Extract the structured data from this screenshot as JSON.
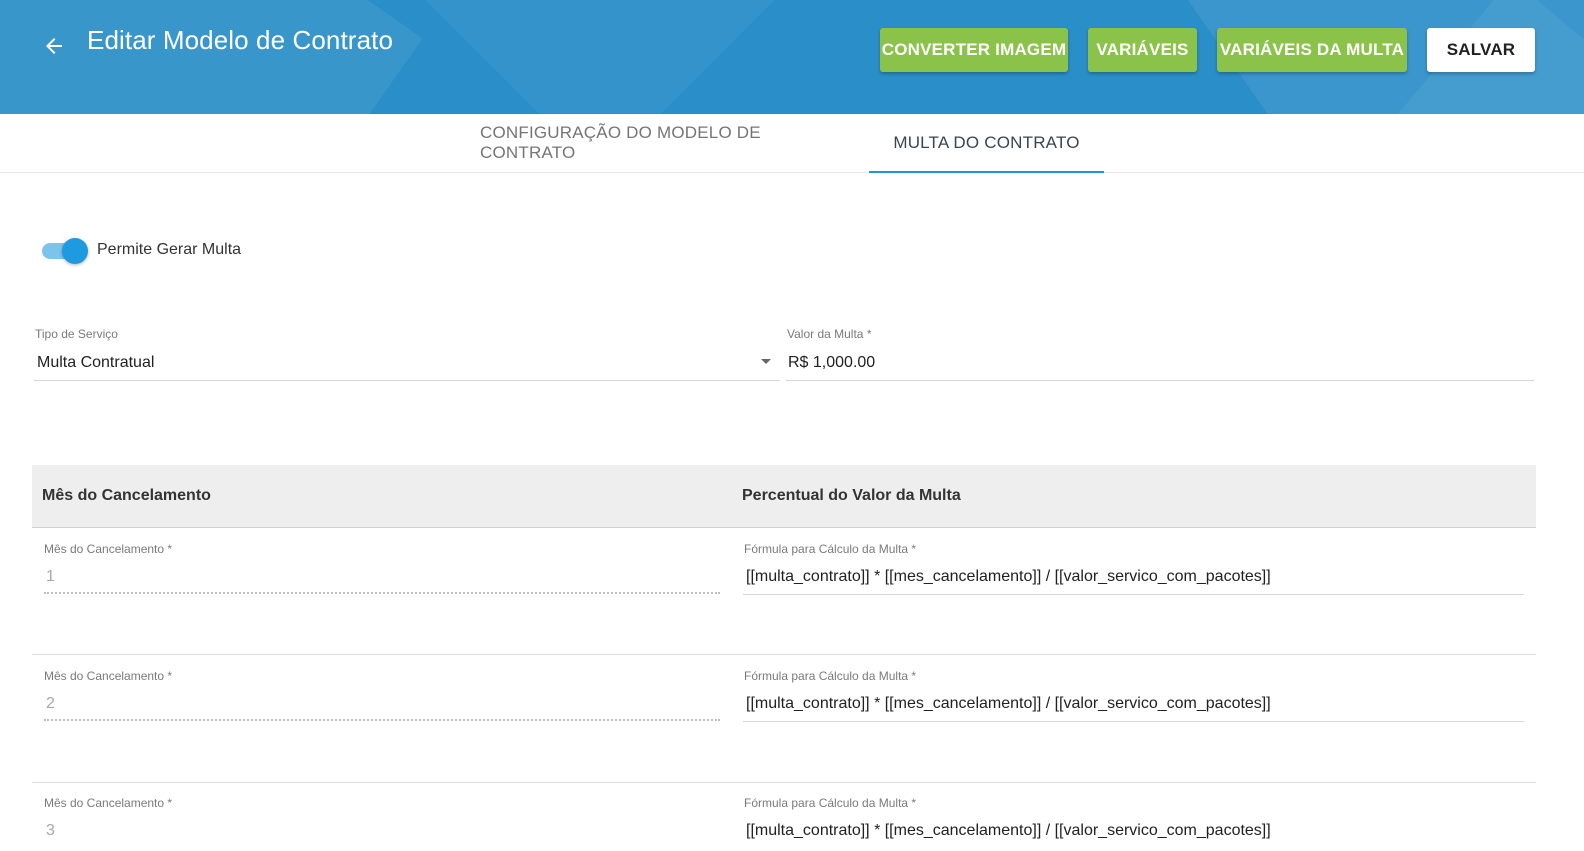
{
  "header": {
    "title": "Editar Modelo de Contrato",
    "buttons": {
      "converter": "CONVERTER IMAGEM",
      "variaveis": "VARIÁVEIS",
      "variaveis_multa": "VARIÁVEIS DA MULTA",
      "salvar": "SALVAR"
    },
    "colors": {
      "bar": "#2a8ec8",
      "green_button": "#8bc34a",
      "tab_indicator": "#2196d3"
    }
  },
  "tabs": [
    {
      "label": "CONFIGURAÇÃO DO MODELO DE CONTRATO",
      "active": false
    },
    {
      "label": "MULTA DO CONTRATO",
      "active": true
    }
  ],
  "toggle": {
    "label": "Permite Gerar Multa",
    "checked": true
  },
  "tipo_servico": {
    "label": "Tipo de Serviço",
    "value": "Multa Contratual"
  },
  "valor_multa": {
    "label": "Valor da Multa *",
    "value": "R$ 1,000.00"
  },
  "table": {
    "headers": [
      "Mês do Cancelamento",
      "Percentual do Valor da Multa"
    ],
    "rows": [
      {
        "mes_label": "Mês do Cancelamento *",
        "mes_value": "1",
        "formula_label": "Fórmula para Cálculo da Multa *",
        "formula_value": "[[multa_contrato]] * [[mes_cancelamento]] / [[valor_servico_com_pacotes]]"
      },
      {
        "mes_label": "Mês do Cancelamento *",
        "mes_value": "2",
        "formula_label": "Fórmula para Cálculo da Multa *",
        "formula_value": "[[multa_contrato]] * [[mes_cancelamento]] / [[valor_servico_com_pacotes]]"
      },
      {
        "mes_label": "Mês do Cancelamento *",
        "mes_value": "3",
        "formula_label": "Fórmula para Cálculo da Multa *",
        "formula_value": "[[multa_contrato]] * [[mes_cancelamento]] / [[valor_servico_com_pacotes]]"
      }
    ]
  }
}
